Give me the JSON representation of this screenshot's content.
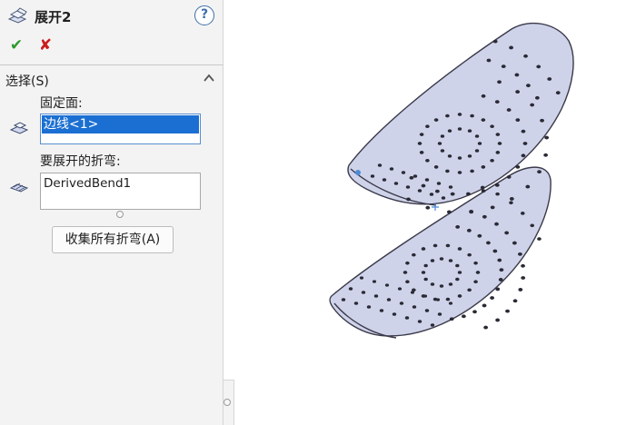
{
  "panel": {
    "feature_icon": "unfold-feature-icon",
    "title": "展开2",
    "help_label": "?",
    "ok_label": "✔",
    "cancel_label": "✘"
  },
  "section": {
    "title": "选择(S)",
    "collapse_icon": "chevron-up-icon"
  },
  "fixed_face": {
    "label": "固定面:",
    "icon": "face-icon",
    "value": "边线<1>"
  },
  "bends": {
    "label": "要展开的折弯:",
    "icon": "bend-icon",
    "items": [
      "DerivedBend1"
    ]
  },
  "collect_button": {
    "label": "收集所有折弯(A)"
  },
  "viewport": {
    "part_fill": "#cfd3ea",
    "edge_color": "#3a3a4a",
    "hole_fill": "#2a2a35"
  }
}
